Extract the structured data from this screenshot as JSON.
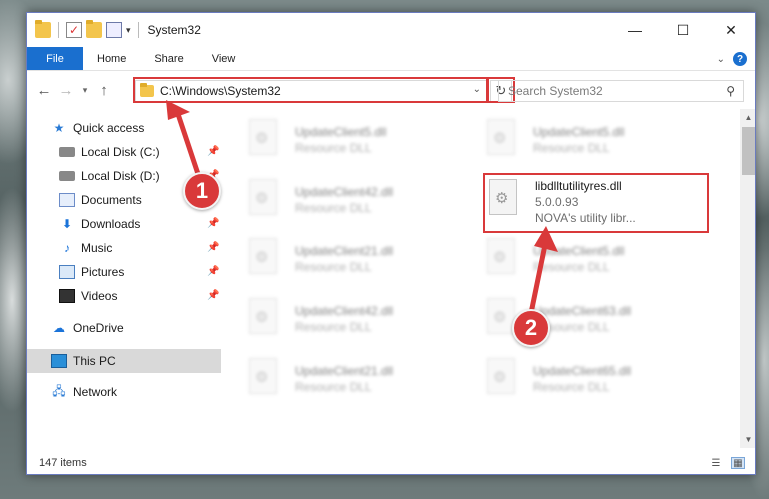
{
  "window": {
    "title": "System32",
    "controls": {
      "minimize": "—",
      "maximize": "☐",
      "close": "✕"
    }
  },
  "ribbon": {
    "file": "File",
    "tabs": [
      "Home",
      "Share",
      "View"
    ]
  },
  "address": {
    "path": "C:\\Windows\\System32",
    "search_placeholder": "Search System32"
  },
  "sidebar": {
    "items": [
      {
        "label": "Quick access",
        "icon": "star-icon"
      },
      {
        "label": "Local Disk (C:)",
        "icon": "disk-icon",
        "pinned": true
      },
      {
        "label": "Local Disk (D:)",
        "icon": "disk-icon",
        "pinned": true
      },
      {
        "label": "Documents",
        "icon": "documents-icon",
        "pinned": true
      },
      {
        "label": "Downloads",
        "icon": "downloads-icon",
        "pinned": true
      },
      {
        "label": "Music",
        "icon": "music-icon",
        "pinned": true
      },
      {
        "label": "Pictures",
        "icon": "pictures-icon",
        "pinned": true
      },
      {
        "label": "Videos",
        "icon": "videos-icon",
        "pinned": true
      },
      {
        "label": "OneDrive",
        "icon": "onedrive-icon"
      },
      {
        "label": "This PC",
        "icon": "this-pc-icon",
        "selected": true
      },
      {
        "label": "Network",
        "icon": "network-icon"
      }
    ]
  },
  "files": {
    "left": [
      {
        "name": "UpdateClient5.dll",
        "desc": "Resource DLL"
      },
      {
        "name": "UpdateClient42.dll",
        "desc": "Resource DLL"
      },
      {
        "name": "UpdateClient21.dll",
        "desc": "Resource DLL"
      },
      {
        "name": "UpdateClient42.dll",
        "desc": "Resource DLL"
      },
      {
        "name": "UpdateClient21.dll",
        "desc": "Resource DLL"
      }
    ],
    "right": [
      {
        "name": "UpdateClient5.dll",
        "desc": "Resource DLL"
      },
      {
        "name": "UpdateClient5.dll",
        "desc": "Resource DLL"
      },
      {
        "name": "UpdateClient63.dll",
        "desc": "Resource DLL"
      },
      {
        "name": "UpdateClient65.dll",
        "desc": "Resource DLL"
      }
    ],
    "highlighted": {
      "name": "libdlltutilityres.dll",
      "version": "5.0.0.93",
      "desc": "NOVA's utility libr..."
    }
  },
  "status": {
    "item_count": "147 items"
  },
  "callouts": {
    "step1": "1",
    "step2": "2"
  },
  "colors": {
    "accent": "#1a6fcf",
    "highlight": "#d9393a"
  }
}
